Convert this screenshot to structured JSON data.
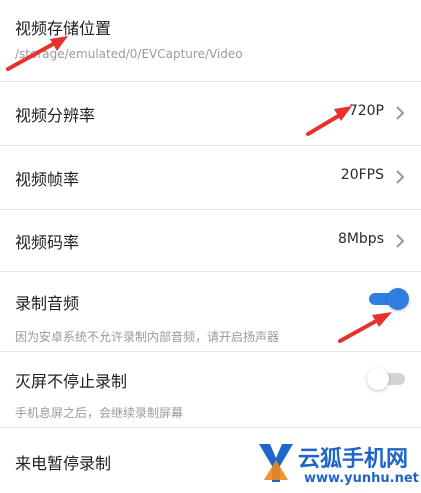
{
  "colors": {
    "accent": "#2f7ee0",
    "toggle_off_track": "#d4d4d4",
    "toggle_off_knob": "#ffffff",
    "annotation_arrow": "#e5322d",
    "watermark_blue": "#1e66c8",
    "watermark_orange": "#f08a1d"
  },
  "settings": {
    "storage": {
      "title": "视频存储位置",
      "path": "/storage/emulated/0/EVCapture/Video"
    },
    "resolution": {
      "title": "视频分辨率",
      "value": "720P"
    },
    "framerate": {
      "title": "视频帧率",
      "value": "20FPS"
    },
    "bitrate": {
      "title": "视频码率",
      "value": "8Mbps"
    },
    "record_audio": {
      "title": "录制音频",
      "desc": "因为安卓系统不允许录制内部音频，请开启扬声器",
      "enabled": true
    },
    "screen_off": {
      "title": "灭屏不停止录制",
      "desc": "手机息屏之后，会继续录制屏幕",
      "enabled": false
    },
    "incoming_call": {
      "title": "来电暂停录制"
    }
  },
  "icons": {
    "chevron": "chevron-right-icon",
    "logo": "fox-logo-icon"
  },
  "watermark": {
    "brand": "云狐手机网",
    "url": "www.yunhu.net"
  }
}
